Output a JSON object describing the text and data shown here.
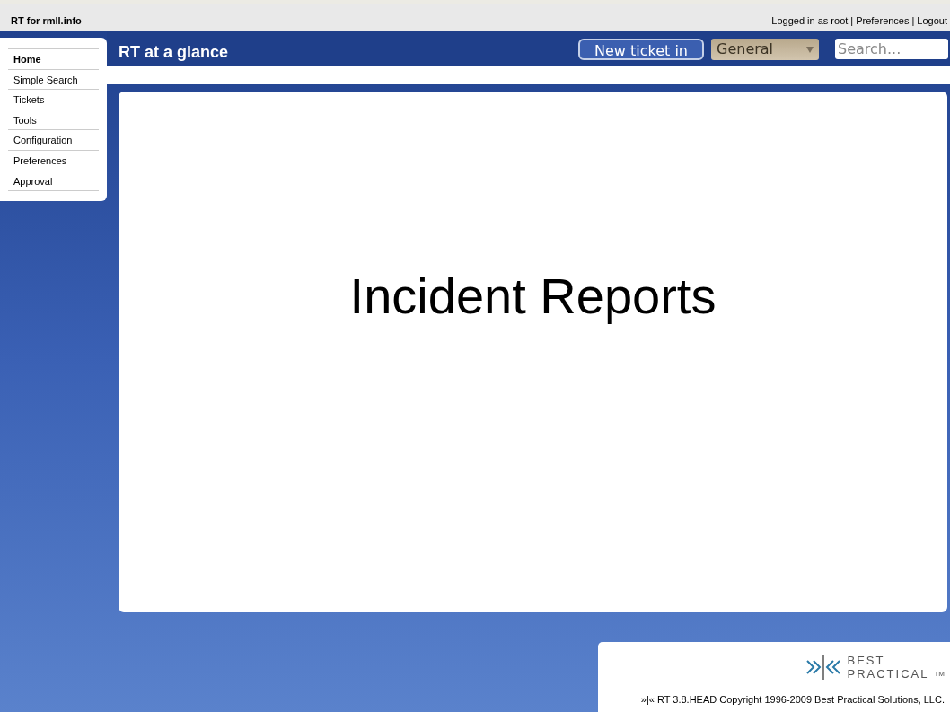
{
  "top_bar": {
    "site_title": "RT for rmll.info",
    "login_status": "Logged in as root",
    "user_links": [
      {
        "separator": "|",
        "link": "Preferences"
      },
      {
        "separator": "|",
        "link": "Logout"
      }
    ]
  },
  "sidebar": {
    "items": [
      {
        "label": "Home",
        "selected": true
      },
      {
        "label": "Simple Search",
        "selected": false
      },
      {
        "label": "Tickets",
        "selected": false
      },
      {
        "label": "Tools",
        "selected": false
      },
      {
        "label": "Configuration",
        "selected": false
      },
      {
        "label": "Preferences",
        "selected": false
      },
      {
        "label": "Approval",
        "selected": false
      }
    ]
  },
  "header": {
    "title": "RT at a glance",
    "new_ticket_button": "New ticket in",
    "queue_select": "General",
    "search": {
      "placeholder": "Search..."
    }
  },
  "content": {
    "heading": "Incident Reports"
  },
  "footer": {
    "logo": {
      "line_1": "BEST",
      "line_2": "PRACTICAL",
      "trademark": "TM"
    },
    "copyright": "»|« RT 3.8.HEAD Copyright 1996-2009 Best Practical Solutions, LLC."
  }
}
